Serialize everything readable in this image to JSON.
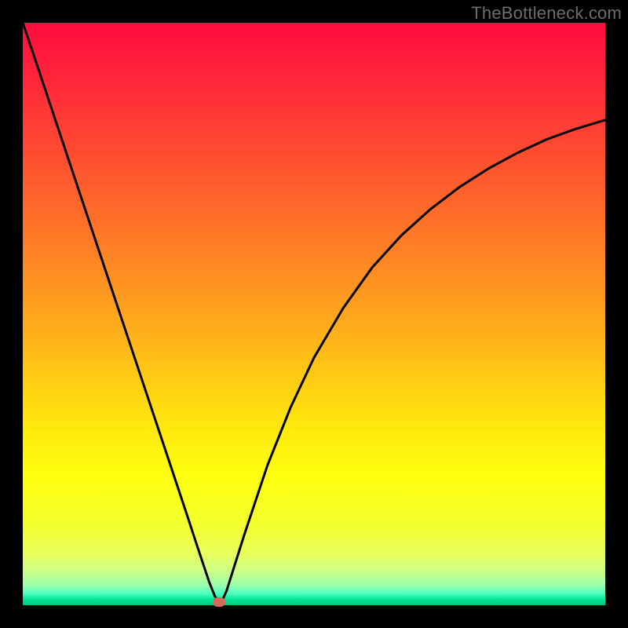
{
  "watermark": "TheBottleneck.com",
  "colors": {
    "frame": "#000000",
    "curve": "#000000",
    "marker": "#d46a5c"
  },
  "chart_data": {
    "type": "line",
    "title": "",
    "xlabel": "",
    "ylabel": "",
    "xlim": [
      0,
      100
    ],
    "ylim": [
      0,
      100
    ],
    "series": [
      {
        "name": "bottleneck-curve",
        "x": [
          0,
          2,
          4,
          6,
          8,
          10,
          12,
          14,
          16,
          18,
          20,
          22,
          24,
          26,
          28,
          30,
          31,
          32,
          33,
          34,
          35,
          38,
          42,
          46,
          50,
          55,
          60,
          65,
          70,
          75,
          80,
          85,
          90,
          95,
          100
        ],
        "y": [
          100,
          94.1,
          88.1,
          82.1,
          76.1,
          70.1,
          64.1,
          58.1,
          52.1,
          46.1,
          40.1,
          34.1,
          28.1,
          22.1,
          16.1,
          10.0,
          7.0,
          4.0,
          1.5,
          0.3,
          2.5,
          12.0,
          24.0,
          34.0,
          42.5,
          51.0,
          58.0,
          63.5,
          68.0,
          71.8,
          75.0,
          77.7,
          80.0,
          81.8,
          83.3
        ]
      }
    ],
    "marker": {
      "x": 33.7,
      "y": 0.6
    },
    "background_gradient": {
      "direction": "top-to-bottom",
      "stops": [
        {
          "pos": 0.0,
          "color": "#ff0d3e"
        },
        {
          "pos": 0.5,
          "color": "#ffa81c"
        },
        {
          "pos": 0.8,
          "color": "#f8ff18"
        },
        {
          "pos": 0.96,
          "color": "#9dffac"
        },
        {
          "pos": 1.0,
          "color": "#00c97f"
        }
      ]
    }
  }
}
